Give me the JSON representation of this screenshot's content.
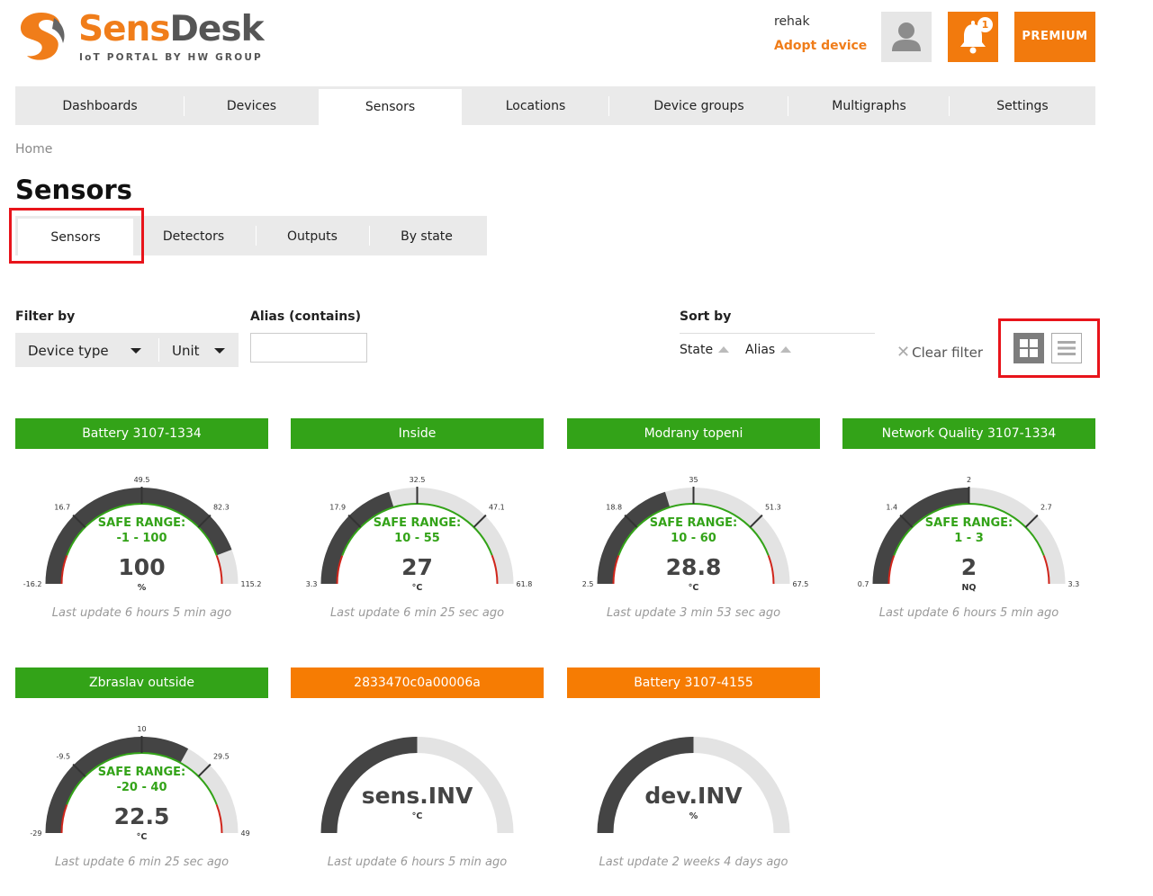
{
  "brand": {
    "name_a": "Sens",
    "name_b": "Desk",
    "subtitle": "IoT PORTAL BY HW GROUP",
    "accent": "#f07d1a"
  },
  "header": {
    "user": "rehak",
    "adopt_label": "Adopt device",
    "notifications_count": "1",
    "premium_label": "PREMIUM",
    "avatar_icon": "user-icon",
    "bell_icon": "bell-icon"
  },
  "nav": {
    "items": [
      "Dashboards",
      "Devices",
      "Sensors",
      "Locations",
      "Device groups",
      "Multigraphs",
      "Settings"
    ],
    "active": "Sensors"
  },
  "breadcrumb": "Home",
  "page_title": "Sensors",
  "tabs": {
    "items": [
      "Sensors",
      "Detectors",
      "Outputs",
      "By state"
    ],
    "active": "Sensors"
  },
  "filters": {
    "label": "Filter by",
    "device_type": "Device type",
    "unit": "Unit",
    "alias_label": "Alias (contains)",
    "alias_value": ""
  },
  "sort": {
    "label": "Sort by",
    "state": "State",
    "alias": "Alias"
  },
  "clear_filter": "Clear filter",
  "colors": {
    "ok": "#33a318",
    "warn": "#f67c03",
    "danger": "#d0251b",
    "gauge_fill": "#444444",
    "gauge_track": "#e3e3e3"
  },
  "sensors": [
    {
      "name": "Battery 3107-1334",
      "status": "ok",
      "min": "-16.2",
      "max": "115.2",
      "ticks": [
        "16.7",
        "49.5",
        "82.3"
      ],
      "range_min": -16.2,
      "range_max": 115.2,
      "safe_label": "SAFE RANGE:",
      "safe_range": "-1 - 100",
      "safe_low": -1,
      "safe_high": 100,
      "value": 100,
      "value_text": "100",
      "unit": "%",
      "last_update": "Last update 6 hours 5 min ago"
    },
    {
      "name": "Inside",
      "status": "ok",
      "min": "3.3",
      "max": "61.8",
      "ticks": [
        "17.9",
        "32.5",
        "47.1"
      ],
      "range_min": 3.3,
      "range_max": 61.8,
      "safe_label": "SAFE RANGE:",
      "safe_range": "10 - 55",
      "safe_low": 10,
      "safe_high": 55,
      "value": 27,
      "value_text": "27",
      "unit": "°C",
      "last_update": "Last update 6 min 25 sec ago"
    },
    {
      "name": "Modrany topeni",
      "status": "ok",
      "min": "2.5",
      "max": "67.5",
      "ticks": [
        "18.8",
        "35",
        "51.3"
      ],
      "range_min": 2.5,
      "range_max": 67.5,
      "safe_label": "SAFE RANGE:",
      "safe_range": "10 - 60",
      "safe_low": 10,
      "safe_high": 60,
      "value": 28.8,
      "value_text": "28.8",
      "unit": "°C",
      "last_update": "Last update 3 min 53 sec ago"
    },
    {
      "name": "Network Quality 3107-1334",
      "status": "ok",
      "min": "0.7",
      "max": "3.3",
      "ticks": [
        "1.4",
        "2",
        "2.7"
      ],
      "range_min": 0.7,
      "range_max": 3.3,
      "safe_label": "SAFE RANGE:",
      "safe_range": "1 - 3",
      "safe_low": 1,
      "safe_high": 3,
      "value": 2,
      "value_text": "2",
      "unit": "NQ",
      "last_update": "Last update 6 hours 5 min ago"
    },
    {
      "name": "Zbraslav outside",
      "status": "ok",
      "min": "-29",
      "max": "49",
      "ticks": [
        "-9.5",
        "10",
        "29.5"
      ],
      "range_min": -29,
      "range_max": 49,
      "safe_label": "SAFE RANGE:",
      "safe_range": "-20 - 40",
      "safe_low": -20,
      "safe_high": 40,
      "value": 22.5,
      "value_text": "22.5",
      "unit": "°C",
      "last_update": "Last update 6 min 25 sec ago"
    },
    {
      "name": "2833470c0a00006a",
      "status": "warn",
      "invalid": true,
      "fill_fraction": 0.5,
      "value_text": "sens.INV",
      "unit": "°C",
      "last_update": "Last update 6 hours 5 min ago"
    },
    {
      "name": "Battery 3107-4155",
      "status": "warn",
      "invalid": true,
      "fill_fraction": 0.5,
      "value_text": "dev.INV",
      "unit": "%",
      "last_update": "Last update 2 weeks 4 days ago"
    }
  ]
}
